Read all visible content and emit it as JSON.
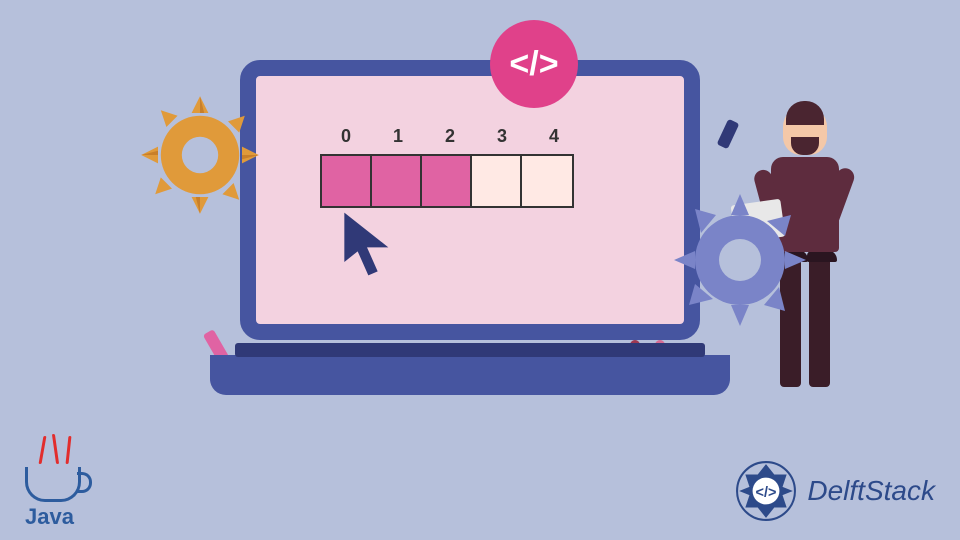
{
  "array": {
    "indices": [
      "0",
      "1",
      "2",
      "3",
      "4"
    ],
    "cells": [
      "filled",
      "filled",
      "filled",
      "empty",
      "empty"
    ]
  },
  "code_badge": "</>",
  "logos": {
    "java": "Java",
    "delftstack": "DelftStack"
  },
  "colors": {
    "bg": "#b6c0db",
    "laptop_frame": "#4655a0",
    "screen": "#f3d2e0",
    "array_filled": "#e063a3",
    "array_empty": "#ffe9e4",
    "badge": "#e0418a",
    "gear_orange": "#e09a3a",
    "gear_blue": "#7a84c8"
  }
}
